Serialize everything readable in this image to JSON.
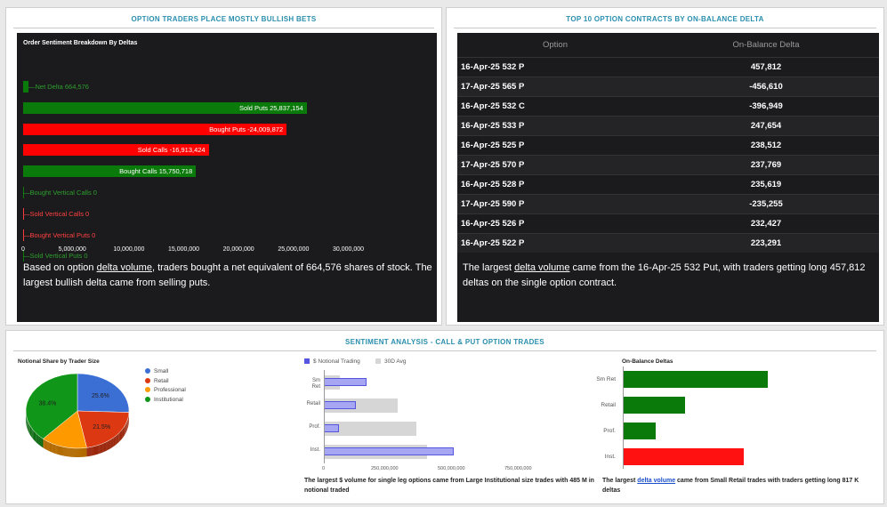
{
  "panel1": {
    "title": "OPTION TRADERS PLACE MOSTLY BULLISH BETS",
    "chart_title": "Order Sentiment Breakdown By Deltas",
    "bars": [
      {
        "label": "Net Delta 664,576",
        "value": 664576,
        "color": "#0a7a0a"
      },
      {
        "label": "Sold Puts 25,837,154",
        "value": 25837154,
        "color": "#0a7a0a"
      },
      {
        "label": "Bought Puts -24,009,872",
        "value": 24009872,
        "color": "#ff0000"
      },
      {
        "label": "Sold Calls -16,913,424",
        "value": 16913424,
        "color": "#ff0000"
      },
      {
        "label": "Bought Calls 15,750,718",
        "value": 15750718,
        "color": "#0a7a0a"
      },
      {
        "label": "Bought Vertical Calls 0",
        "value": 0,
        "color": "#0a7a0a"
      },
      {
        "label": "Sold Vertical Calls 0",
        "value": 0,
        "color": "#ff3b3b"
      },
      {
        "label": "Bought Vertical Puts 0",
        "value": 0,
        "color": "#ff3b3b"
      },
      {
        "label": "Sold Vertical Puts 0",
        "value": 0,
        "color": "#0a7a0a"
      }
    ],
    "ticks": [
      "0",
      "5,000,000",
      "10,000,000",
      "15,000,000",
      "20,000,000",
      "25,000,000",
      "30,000,000"
    ],
    "summary_pre": "Based on option ",
    "summary_link": "delta volume",
    "summary_post": ", traders bought a net equivalent of 664,576 shares of stock. The largest bullish delta came from selling puts."
  },
  "panel2": {
    "title": "TOP 10 OPTION CONTRACTS BY ON-BALANCE DELTA",
    "col_option": "Option",
    "col_delta": "On-Balance Delta",
    "rows": [
      {
        "option": "16-Apr-25 532 P",
        "delta": "457,812"
      },
      {
        "option": "17-Apr-25 565 P",
        "delta": "-456,610"
      },
      {
        "option": "16-Apr-25 532 C",
        "delta": "-396,949"
      },
      {
        "option": "16-Apr-25 533 P",
        "delta": "247,654"
      },
      {
        "option": "16-Apr-25 525 P",
        "delta": "238,512"
      },
      {
        "option": "17-Apr-25 570 P",
        "delta": "237,769"
      },
      {
        "option": "16-Apr-25 528 P",
        "delta": "235,619"
      },
      {
        "option": "17-Apr-25 590 P",
        "delta": "-235,255"
      },
      {
        "option": "16-Apr-25 526 P",
        "delta": "232,427"
      },
      {
        "option": "16-Apr-25 522 P",
        "delta": "223,291"
      }
    ],
    "summary_pre": "The largest ",
    "summary_link": "delta volume",
    "summary_post": " came from the 16-Apr-25 532 Put, with traders getting long 457,812 deltas on the single option contract."
  },
  "panel3": {
    "title": "SENTIMENT ANALYSIS - CALL & PUT OPTION TRADES",
    "pie": {
      "title": "Notional Share by Trader Size",
      "legend": [
        {
          "name": "Small",
          "color": "#3b6fd4"
        },
        {
          "name": "Retail",
          "color": "#dc3912"
        },
        {
          "name": "Professional",
          "color": "#ff9900"
        },
        {
          "name": "Institutional",
          "color": "#109618"
        }
      ],
      "slices": [
        {
          "name": "Small",
          "pct": 25.6,
          "label": "25.6%",
          "color": "#3b6fd4"
        },
        {
          "name": "Retail",
          "pct": 21.5,
          "label": "21.5%",
          "color": "#dc3912"
        },
        {
          "name": "Professional",
          "pct": 14.5,
          "label": "",
          "color": "#ff9900"
        },
        {
          "name": "Institutional",
          "pct": 38.4,
          "label": "38.4%",
          "color": "#109618"
        }
      ]
    },
    "notional": {
      "legend_a": "$ Notional Trading",
      "legend_b": "30D Avg",
      "categories": [
        "Sm Ret",
        "Retail",
        "Prof.",
        "Inst."
      ],
      "values": [
        160000000,
        120000000,
        55000000,
        485000000
      ],
      "avg": [
        60000000,
        275000000,
        345000000,
        385000000
      ],
      "ticks": [
        "0",
        "250,000,000",
        "500,000,000",
        "750,000,000"
      ],
      "caption": "The largest $ volume for single leg options came from Large Institutional size trades with 485 M in notional traded"
    },
    "obd": {
      "title": "On-Balance Deltas",
      "categories": [
        "Sm Ret",
        "Retail",
        "Prof.",
        "Inst."
      ],
      "values": [
        817000,
        350000,
        185000,
        -680000
      ],
      "caption_pre": "The largest ",
      "caption_link": "delta volume",
      "caption_post": " came from Small Retail trades with traders getting long 817 K deltas"
    }
  }
}
